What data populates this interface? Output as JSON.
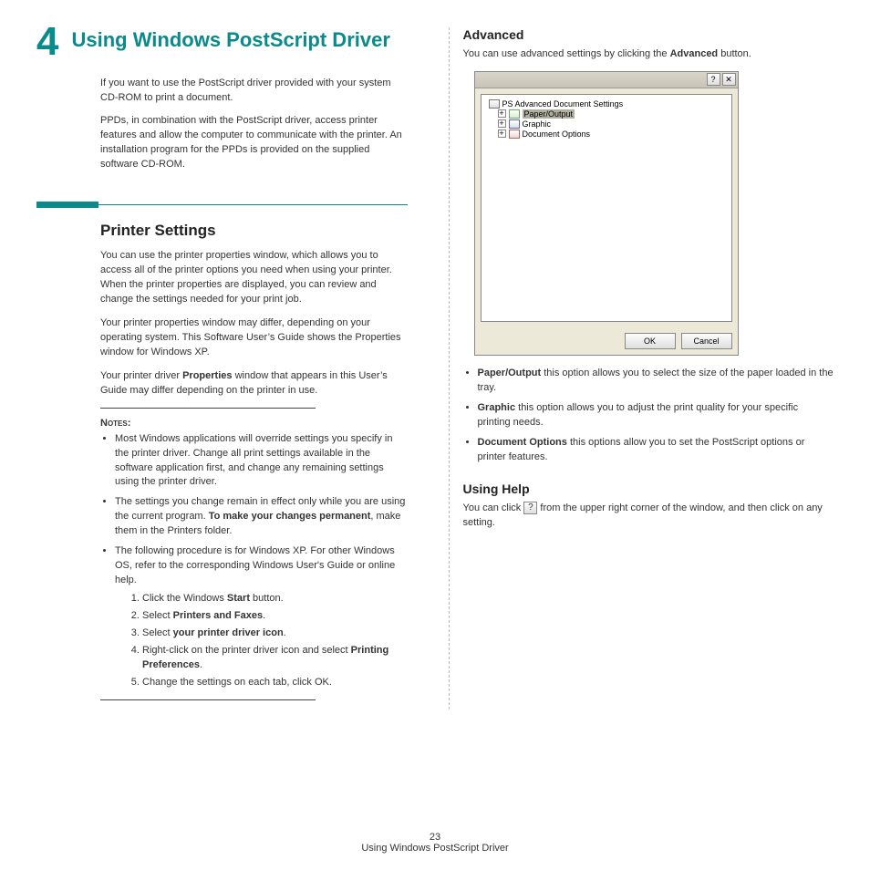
{
  "chapter": {
    "number": "4",
    "title": "Using Windows PostScript Driver"
  },
  "intro": {
    "p1": "If you want to use the PostScript driver provided with your system CD-ROM to print a document.",
    "p2": "PPDs, in combination with the PostScript driver, access printer features and allow the computer to communicate with the printer. An installation program for the PPDs is provided on the supplied software CD-ROM."
  },
  "printer_settings": {
    "heading": "Printer Settings",
    "p1": "You can use the printer properties window, which allows you to access all of the printer options you need when using your printer. When the printer properties are displayed, you can review and change the settings needed for your print job.",
    "p2": "Your printer properties window may differ, depending on your operating system. This Software User’s Guide shows the Properties window for Windows XP.",
    "p3_a": "Your printer driver ",
    "p3_b": "Properties",
    "p3_c": " window that appears in this User’s Guide may differ depending on the printer in use.",
    "notes_label": "Notes",
    "bullet1": "Most Windows applications will override settings you specify in the printer driver. Change all print settings available in the software application first, and change any remaining settings using the printer driver.",
    "bullet2_a": "The settings you change remain in effect only while you are using the current program. ",
    "bullet2_b": "To make your changes permanent",
    "bullet2_c": ", make them in the Printers folder.",
    "bullet3": "The following procedure is for Windows XP. For other Windows OS, refer to the corresponding Windows User's Guide or online help.",
    "step1_a": "Click the Windows ",
    "step1_b": "Start",
    "step1_c": " button.",
    "step2_a": "Select ",
    "step2_b": "Printers and Faxes",
    "step2_c": ".",
    "step3_a": "Select ",
    "step3_b": "your printer driver icon",
    "step3_c": ".",
    "step4_a": "Right-click on the printer driver icon and select ",
    "step4_b": "Printing Preferences",
    "step4_c": ".",
    "step5": "Change the settings on each tab, click OK."
  },
  "advanced": {
    "heading": "Advanced",
    "p_a": "You can use advanced settings by clicking the ",
    "p_b": "Advanced",
    "p_c": " button.",
    "dialog": {
      "root": "PS Advanced Document Settings",
      "n1": "Paper/Output",
      "n2": "Graphic",
      "n3": "Document Options",
      "ok": "OK",
      "cancel": "Cancel",
      "help_glyph": "?",
      "close_glyph": "✕"
    },
    "b1_a": "Paper/Output",
    "b1_b": " this option allows you to select the size of the paper loaded in the tray.",
    "b2_a": "Graphic",
    "b2_b": " this option allows you to adjust the print quality for your specific printing needs.",
    "b3_a": "Document Options",
    "b3_b": " this options allow you to set the PostScript options or printer features."
  },
  "using_help": {
    "heading": "Using Help",
    "p_a": "You can click ",
    "p_b": " from the upper right corner of the window, and then click on any setting.",
    "help_glyph": "?"
  },
  "footer": {
    "page_num": "23",
    "running": "Using Windows PostScript Driver"
  }
}
